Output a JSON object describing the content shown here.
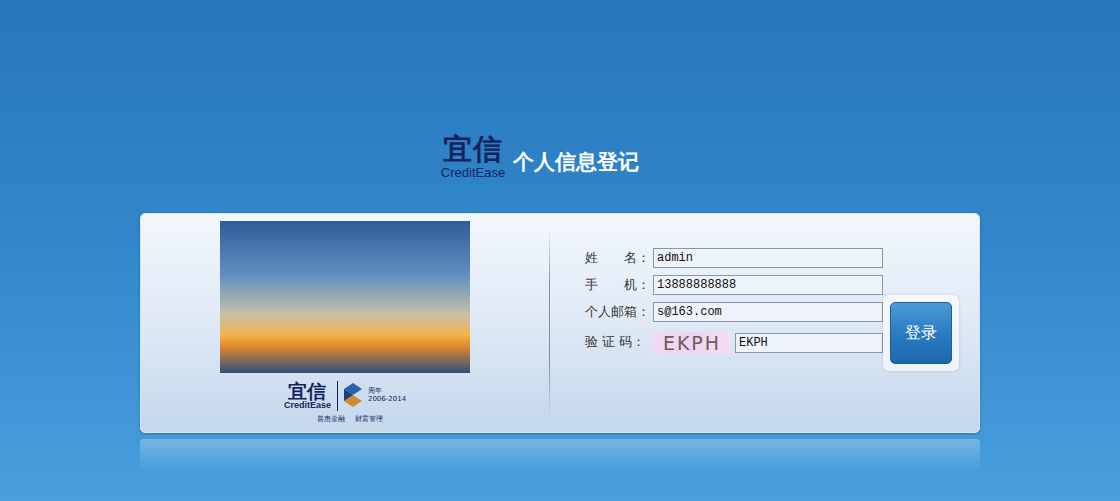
{
  "header": {
    "logo": "宜信",
    "logo_en": "CreditEase",
    "title": "个人信息登记"
  },
  "brand_logo": {
    "name": "宜信",
    "name_en": "CreditEase",
    "anniversary": "周年",
    "years": "2006-2014",
    "slogans": [
      "普惠金融",
      "财富管理"
    ]
  },
  "form": {
    "fields": [
      {
        "label": "姓　　名：",
        "value": "admin"
      },
      {
        "label": "手　　机：",
        "value": "13888888888"
      },
      {
        "label": "个人邮箱：",
        "value": "s@163.com"
      }
    ],
    "captcha": {
      "label": "验 证 码：",
      "code": "EKPH",
      "value": "EKPH"
    }
  },
  "buttons": [
    "登录"
  ]
}
